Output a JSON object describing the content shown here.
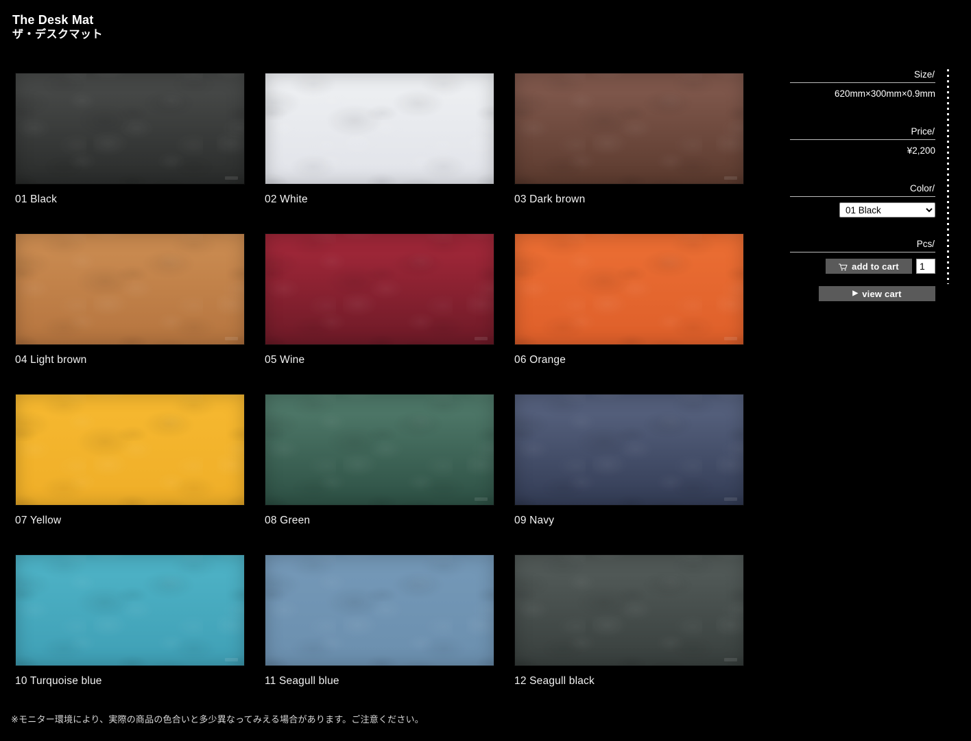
{
  "header": {
    "title_en": "The Desk Mat",
    "title_jp": "ザ・デスクマット"
  },
  "swatches": [
    {
      "label": "01 Black",
      "top": "#454746",
      "bottom": "#2a2c2b",
      "logo": true
    },
    {
      "label": "02 White",
      "top": "#eceef1",
      "bottom": "#e1e3e9",
      "logo": false
    },
    {
      "label": "03 Dark brown",
      "top": "#7d564a",
      "bottom": "#5b3a2e",
      "logo": true
    },
    {
      "label": "04 Light brown",
      "top": "#c8894f",
      "bottom": "#b5743f",
      "logo": true
    },
    {
      "label": "05 Wine",
      "top": "#9c2637",
      "bottom": "#6d1a27",
      "logo": true
    },
    {
      "label": "06 Orange",
      "top": "#e96c32",
      "bottom": "#de5f2a",
      "logo": true
    },
    {
      "label": "07 Yellow",
      "top": "#f5b72f",
      "bottom": "#efae28",
      "logo": false
    },
    {
      "label": "08 Green",
      "top": "#4c7566",
      "bottom": "#2d5044",
      "logo": true
    },
    {
      "label": "09 Navy",
      "top": "#535e7a",
      "bottom": "#333c55",
      "logo": true
    },
    {
      "label": "10 Turquoise blue",
      "top": "#4cb0c4",
      "bottom": "#3f9fb5",
      "logo": true
    },
    {
      "label": "11 Seagull blue",
      "top": "#7397b6",
      "bottom": "#6b8fae",
      "logo": false
    },
    {
      "label": "12 Seagull black",
      "top": "#505856",
      "bottom": "#383f3d",
      "logo": true
    }
  ],
  "panel": {
    "size_label": "Size/",
    "size_value": "620mm×300mm×0.9mm",
    "price_label": "Price/",
    "price_value": "¥2,200",
    "color_label": "Color/",
    "color_selected": "01 Black",
    "color_options": [
      "01 Black",
      "02 White",
      "03 Dark brown",
      "04 Light brown",
      "05 Wine",
      "06 Orange",
      "07 Yellow",
      "08 Green",
      "09 Navy",
      "10 Turquoise blue",
      "11 Seagull blue",
      "12 Seagull black"
    ],
    "pcs_label": "Pcs/",
    "add_to_cart_label": "add to cart",
    "view_cart_label": "view cart",
    "view_cart_marker": "▶",
    "quantity": "1",
    "cart_icon": "cart-icon"
  },
  "footnote": "※モニター環境により、実際の商品の色合いと多少異なってみえる場合があります。ご注意ください。"
}
